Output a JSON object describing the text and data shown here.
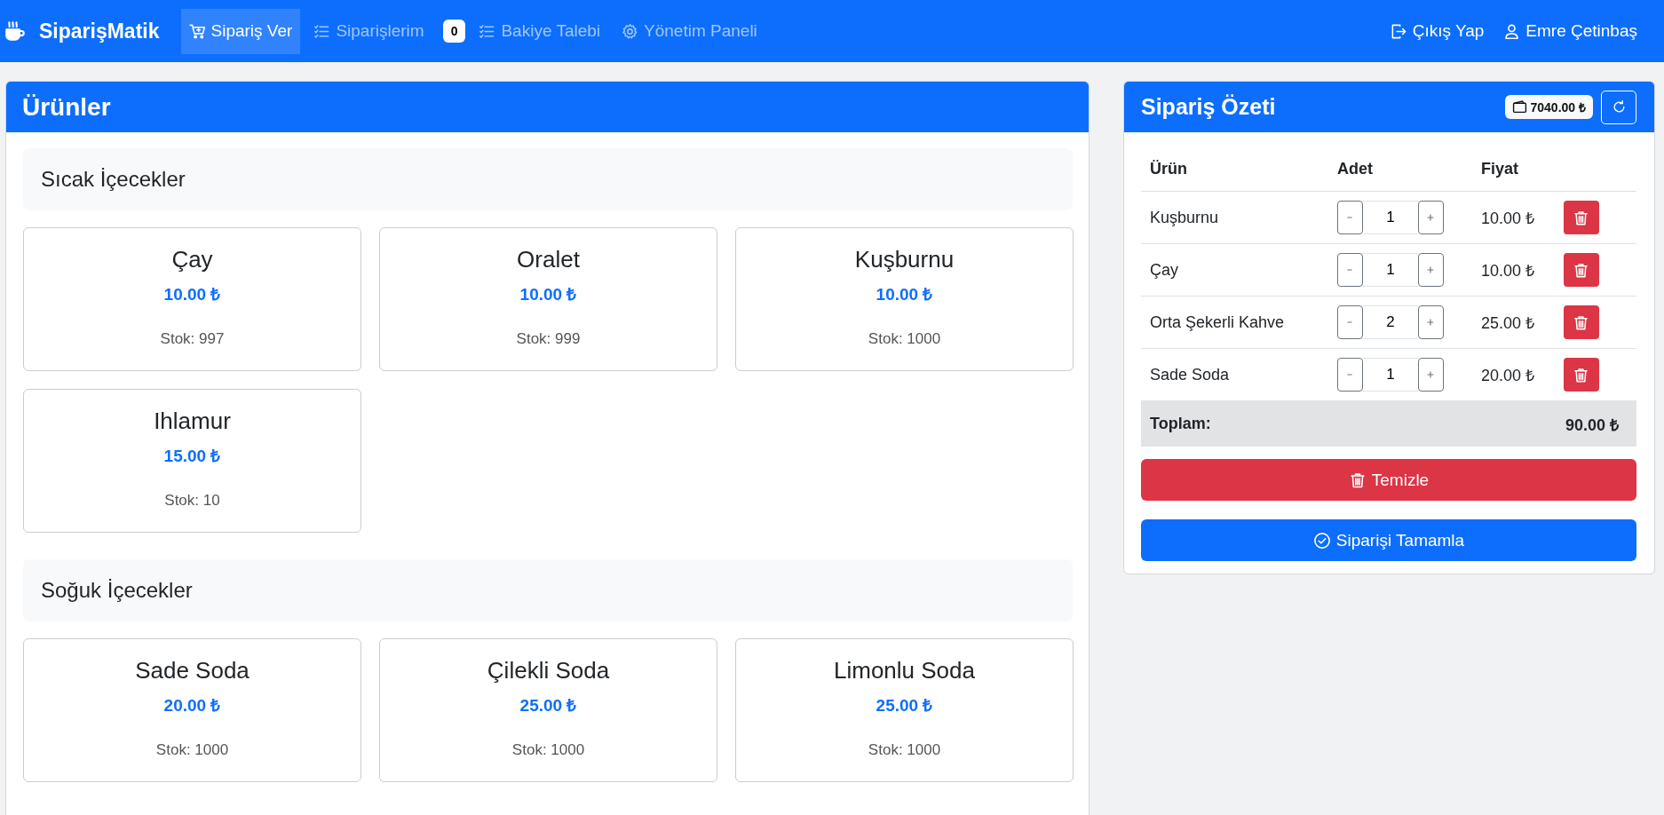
{
  "navbar": {
    "brand": "SiparişMatik",
    "items": [
      {
        "label": "Sipariş Ver",
        "selected": true
      },
      {
        "label": "Siparişlerim",
        "selected": false,
        "badge": "0"
      },
      {
        "label": "Bakiye Talebi",
        "selected": false
      },
      {
        "label": "Yönetim Paneli",
        "selected": false
      }
    ],
    "logout": "Çıkış Yap",
    "user": "Emre Çetinbaş"
  },
  "products": {
    "title": "Ürünler",
    "categories": [
      {
        "name": "Sıcak İçecekler",
        "items": [
          {
            "name": "Çay",
            "price": "10.00 ₺",
            "stock": "Stok: 997"
          },
          {
            "name": "Oralet",
            "price": "10.00 ₺",
            "stock": "Stok: 999"
          },
          {
            "name": "Kuşburnu",
            "price": "10.00 ₺",
            "stock": "Stok: 1000"
          },
          {
            "name": "Ihlamur",
            "price": "15.00 ₺",
            "stock": "Stok: 10"
          }
        ]
      },
      {
        "name": "Soğuk İçecekler",
        "items": [
          {
            "name": "Sade Soda",
            "price": "20.00 ₺",
            "stock": "Stok: 1000"
          },
          {
            "name": "Çilekli Soda",
            "price": "25.00 ₺",
            "stock": "Stok: 1000"
          },
          {
            "name": "Limonlu Soda",
            "price": "25.00 ₺",
            "stock": "Stok: 1000"
          }
        ]
      }
    ]
  },
  "summary": {
    "title": "Sipariş Özeti",
    "balance": "7040.00 ₺",
    "columns": [
      "Ürün",
      "Adet",
      "Fiyat"
    ],
    "rows": [
      {
        "name": "Kuşburnu",
        "qty": "1",
        "price": "10.00 ₺"
      },
      {
        "name": "Çay",
        "qty": "1",
        "price": "10.00 ₺"
      },
      {
        "name": "Orta Şekerli Kahve",
        "qty": "2",
        "price": "25.00 ₺"
      },
      {
        "name": "Sade Soda",
        "qty": "1",
        "price": "20.00 ₺"
      }
    ],
    "total_label": "Toplam:",
    "total": "90.00 ₺",
    "clear_button": "Temizle",
    "complete_button": "Siparişi Tamamla"
  }
}
